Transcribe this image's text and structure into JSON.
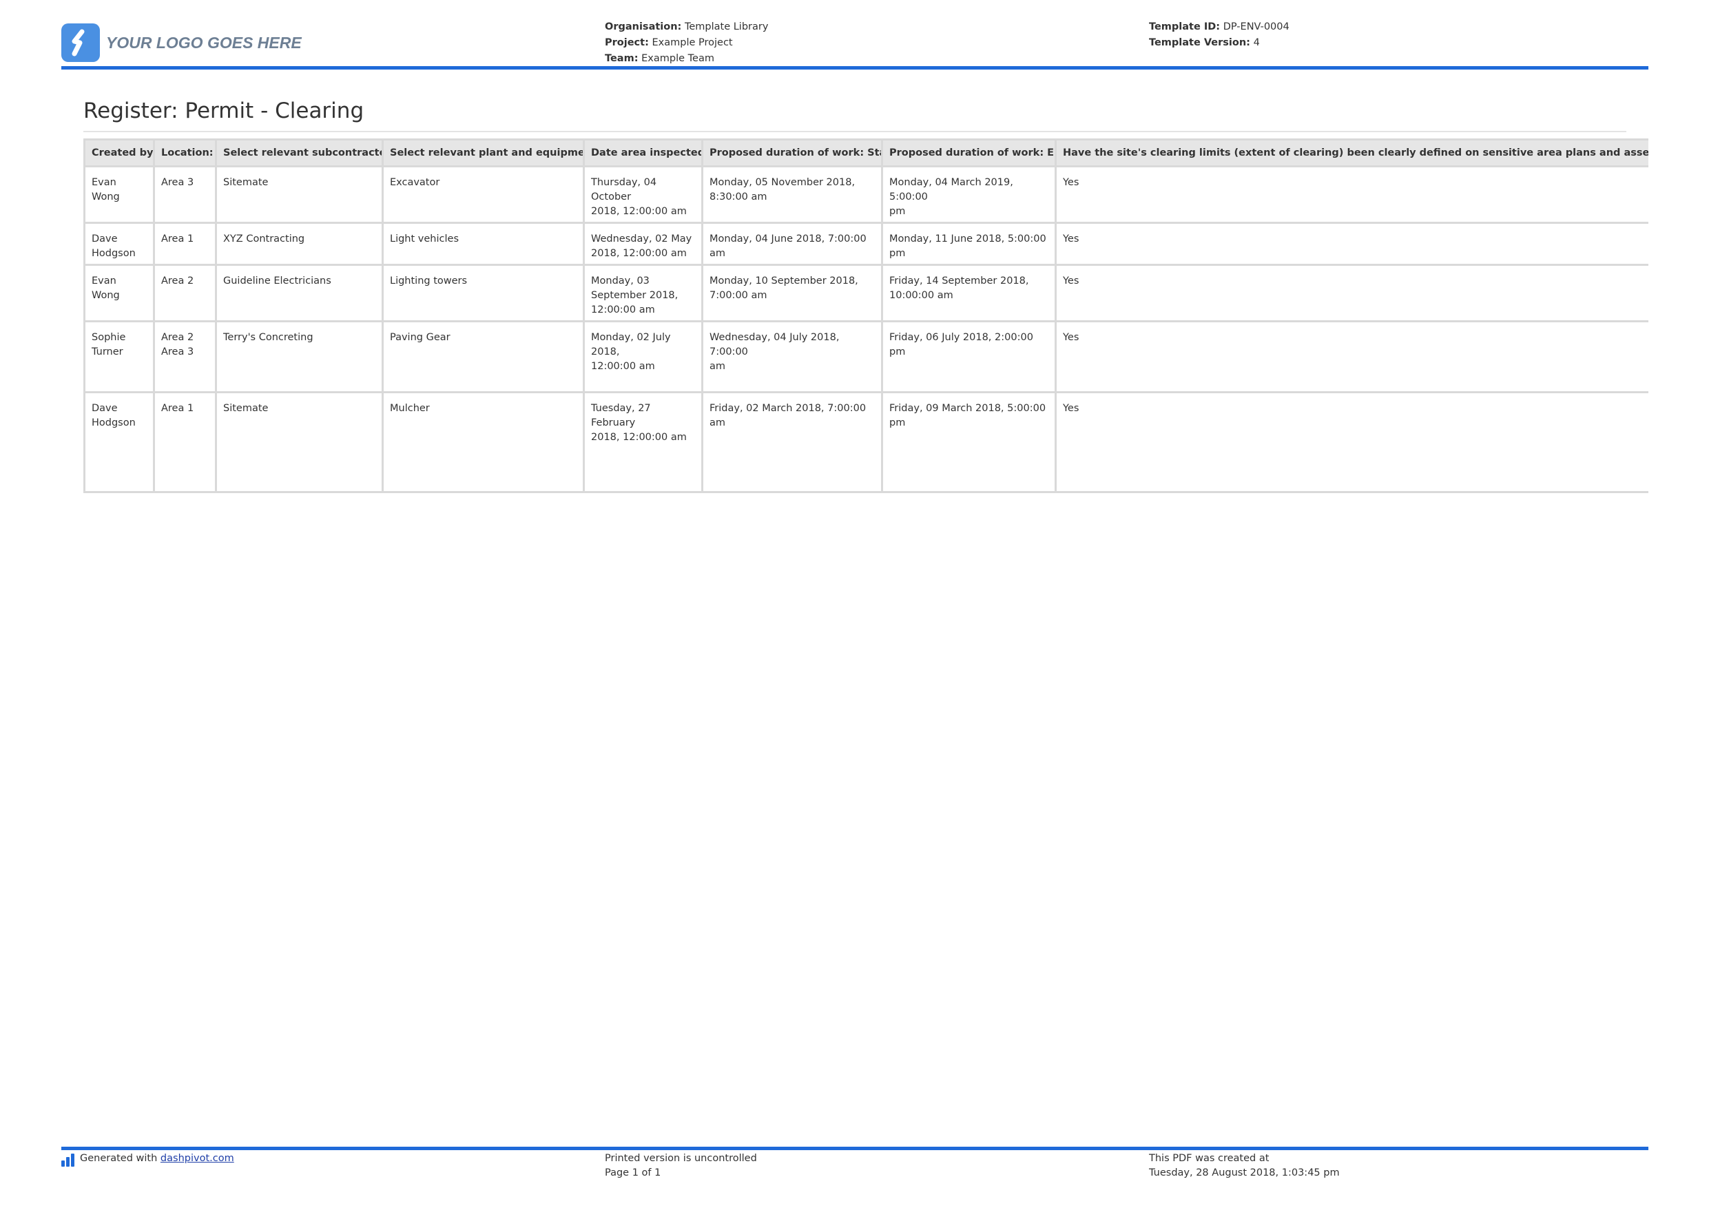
{
  "logo": {
    "text": "YOUR LOGO GOES HERE",
    "icon": "dashpivot-logo-icon"
  },
  "header": {
    "organisation_label": "Organisation:",
    "organisation_value": "Template Library",
    "project_label": "Project:",
    "project_value": "Example Project",
    "team_label": "Team:",
    "team_value": "Example Team",
    "template_id_label": "Template ID:",
    "template_id_value": "DP-ENV-0004",
    "template_version_label": "Template Version:",
    "template_version_value": "4"
  },
  "title": "Register: Permit - Clearing",
  "table": {
    "columns": [
      "Created by",
      "Location:",
      "Select relevant subcontractor:",
      "Select relevant plant and equipment:",
      "Date area inspected:",
      "Proposed duration of work: Start",
      "Proposed duration of work: End",
      "Have the site's clearing limits (extent of clearing) been clearly defined on sensitive area plans and assessed against oth"
    ],
    "rows": [
      {
        "created_by": [
          "Evan Wong"
        ],
        "location": [
          "Area 3"
        ],
        "subcontractor": "Sitemate",
        "plant": "Excavator",
        "date_inspected": [
          "Thursday, 04 October",
          "2018, 12:00:00 am"
        ],
        "start": [
          "Monday, 05 November 2018,",
          "8:30:00 am"
        ],
        "end": [
          "Monday, 04 March 2019, 5:00:00",
          "pm"
        ],
        "limits_defined": "Yes"
      },
      {
        "created_by": [
          "Dave",
          "Hodgson"
        ],
        "location": [
          "Area 1"
        ],
        "subcontractor": "XYZ Contracting",
        "plant": "Light vehicles",
        "date_inspected": [
          "Wednesday, 02 May",
          "2018, 12:00:00 am"
        ],
        "start": [
          "Monday, 04 June 2018, 7:00:00 am"
        ],
        "end": [
          "Monday, 11 June 2018, 5:00:00 pm"
        ],
        "limits_defined": "Yes"
      },
      {
        "created_by": [
          "Evan Wong"
        ],
        "location": [
          "Area 2"
        ],
        "subcontractor": "Guideline Electricians",
        "plant": "Lighting towers",
        "date_inspected": [
          "Monday, 03",
          "September 2018,",
          "12:00:00 am"
        ],
        "start": [
          "Monday, 10 September 2018,",
          "7:00:00 am"
        ],
        "end": [
          "Friday, 14 September 2018,",
          "10:00:00 am"
        ],
        "limits_defined": "Yes"
      },
      {
        "created_by": [
          "Sophie",
          "Turner"
        ],
        "location": [
          "Area 2",
          "Area 3"
        ],
        "subcontractor": "Terry's Concreting",
        "plant": "Paving Gear",
        "date_inspected": [
          "Monday, 02 July 2018,",
          "12:00:00 am"
        ],
        "start": [
          "Wednesday, 04 July 2018, 7:00:00",
          "am"
        ],
        "end": [
          "Friday, 06 July 2018, 2:00:00 pm"
        ],
        "limits_defined": "Yes"
      },
      {
        "created_by": [
          "Dave",
          "Hodgson"
        ],
        "location": [
          "Area 1"
        ],
        "subcontractor": "Sitemate",
        "plant": "Mulcher",
        "date_inspected": [
          "Tuesday, 27 February",
          "2018, 12:00:00 am"
        ],
        "start": [
          "Friday, 02 March 2018, 7:00:00 am"
        ],
        "end": [
          "Friday, 09 March 2018, 5:00:00 pm"
        ],
        "limits_defined": "Yes"
      }
    ]
  },
  "footer": {
    "generated_prefix": "Generated with",
    "generated_link": "dashpivot.com",
    "printed_notice": "Printed version is uncontrolled",
    "page_info": "Page 1 of 1",
    "created_label": "This PDF was created at",
    "created_at": "Tuesday, 28 August 2018, 1:03:45 pm",
    "icon": "bar-chart-icon"
  },
  "colors": {
    "accent": "#1f6ad9",
    "logo_badge": "#4a90e2",
    "logo_text": "#6d7f94",
    "table_header_bg": "#e6e6e6",
    "table_border": "#d9d9d9"
  }
}
